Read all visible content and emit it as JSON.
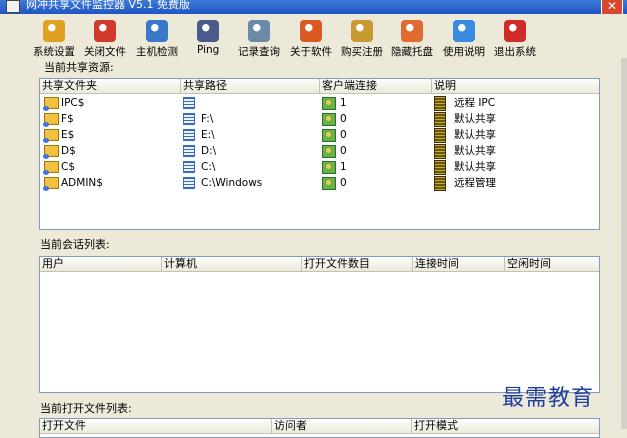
{
  "window": {
    "title": "网冲共享文件监控器 V5.1 免费版"
  },
  "toolbar": {
    "buttons": [
      {
        "label": "系统设置",
        "icon": "gear-icon",
        "color": "#e0a020"
      },
      {
        "label": "关闭文件",
        "icon": "close-file-icon",
        "color": "#d03a2a"
      },
      {
        "label": "主机检测",
        "icon": "globe-icon",
        "color": "#3a78c8"
      },
      {
        "label": "Ping",
        "icon": "ping-icon",
        "color": "#4a5a8a"
      },
      {
        "label": "记录查询",
        "icon": "monitor-icon",
        "color": "#6a8aa8"
      },
      {
        "label": "关于软件",
        "icon": "info-icon",
        "color": "#d85a20"
      },
      {
        "label": "购买注册",
        "icon": "key-icon",
        "color": "#c89a30"
      },
      {
        "label": "隐藏托盘",
        "icon": "tray-icon",
        "color": "#e06a30"
      },
      {
        "label": "使用说明",
        "icon": "help-icon",
        "color": "#3a8ae0"
      },
      {
        "label": "退出系统",
        "icon": "exit-icon",
        "color": "#d02a2a"
      }
    ]
  },
  "shares": {
    "label": "当前共享资源:",
    "columns": [
      "共享文件夹",
      "共享路径",
      "客户端连接",
      "说明"
    ],
    "rows": [
      {
        "name": "IPC$",
        "path": "",
        "clients": "1",
        "desc": "远程 IPC"
      },
      {
        "name": "F$",
        "path": "F:\\",
        "clients": "0",
        "desc": "默认共享"
      },
      {
        "name": "E$",
        "path": "E:\\",
        "clients": "0",
        "desc": "默认共享"
      },
      {
        "name": "D$",
        "path": "D:\\",
        "clients": "0",
        "desc": "默认共享"
      },
      {
        "name": "C$",
        "path": "C:\\",
        "clients": "1",
        "desc": "默认共享"
      },
      {
        "name": "ADMIN$",
        "path": "C:\\Windows",
        "clients": "0",
        "desc": "远程管理"
      }
    ]
  },
  "sessions": {
    "label": "当前会话列表:",
    "columns": [
      "用户",
      "计算机",
      "打开文件数目",
      "连接时间",
      "空闲时间"
    ]
  },
  "open_files": {
    "label": "当前打开文件列表:",
    "columns": [
      "打开文件",
      "访问者",
      "打开模式"
    ]
  },
  "watermark": "最需教育"
}
